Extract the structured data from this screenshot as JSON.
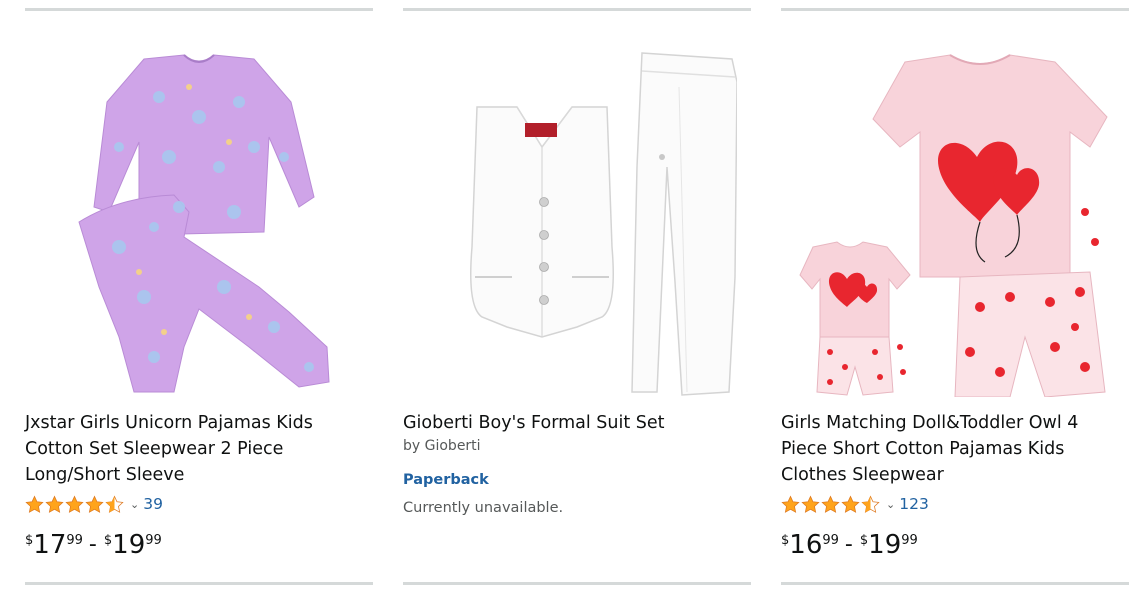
{
  "products": [
    {
      "title": "Jxstar Girls Unicorn Pajamas Kids Cotton Set Sleepwear 2 Piece Long/Short Sleeve",
      "rating": 4.5,
      "rating_count": "39",
      "price_low": {
        "currency": "$",
        "whole": "17",
        "fraction": "99"
      },
      "price_high": {
        "currency": "$",
        "whole": "19",
        "fraction": "99"
      },
      "price_separator": "-",
      "image_icon": "unicorn-pajamas-image"
    },
    {
      "title": "Gioberti Boy's Formal Suit Set",
      "byline": "by Gioberti",
      "format": "Paperback",
      "availability": "Currently unavailable.",
      "image_icon": "formal-suit-image"
    },
    {
      "title": "Girls Matching Doll&Toddler Owl 4 Piece Short Cotton Pajamas Kids Clothes Sleepwear",
      "rating": 4.5,
      "rating_count": "123",
      "price_low": {
        "currency": "$",
        "whole": "16",
        "fraction": "99"
      },
      "price_high": {
        "currency": "$",
        "whole": "19",
        "fraction": "99"
      },
      "price_separator": "-",
      "image_icon": "heart-pajamas-image"
    }
  ],
  "colors": {
    "link": "#2162A1",
    "star": "#FFA41C",
    "text": "#0F1111",
    "muted": "#565959",
    "rule": "#D5D9D9"
  }
}
